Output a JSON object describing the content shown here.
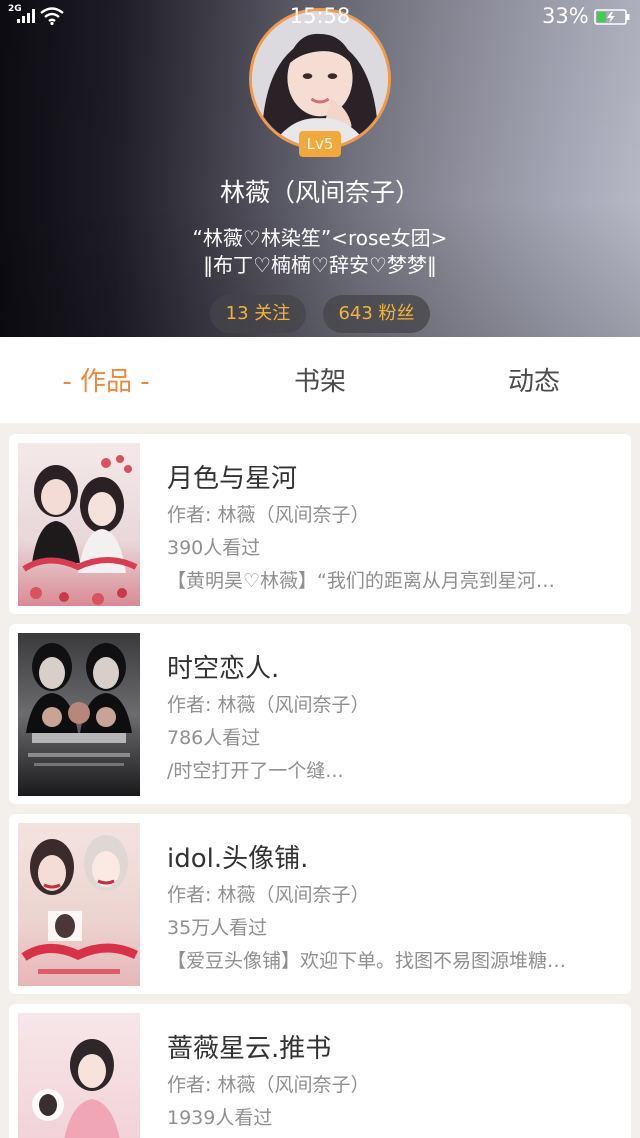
{
  "status_bar": {
    "network": "2G",
    "time": "15:58",
    "battery_percent": "33%",
    "battery_level": 0.33,
    "icons": [
      "signal-icon",
      "wifi-icon",
      "battery-icon"
    ]
  },
  "profile": {
    "level": "Lv5",
    "name": "林薇（风间奈子）",
    "bio_line1": "“林薇♡林染笙”<rose女团>",
    "bio_line2": "‖布丁♡楠楠♡辞安♡梦梦‖",
    "following": "13 关注",
    "followers": "643 粉丝"
  },
  "tabs": [
    {
      "label": "- 作品 -",
      "active": true
    },
    {
      "label": "书架",
      "active": false
    },
    {
      "label": "动态",
      "active": false
    }
  ],
  "books": [
    {
      "title": "月色与星河",
      "author": "作者: 林薇（风间奈子）",
      "views": "390人看过",
      "desc": "【黄明昊♡林薇】“我们的距离从月亮到星河…"
    },
    {
      "title": "时空恋人.",
      "author": "作者: 林薇（风间奈子）",
      "views": "786人看过",
      "desc": "/时空打开了一个缝..."
    },
    {
      "title": "idol.头像铺.",
      "author": "作者: 林薇（风间奈子）",
      "views": "35万人看过",
      "desc": "【爱豆头像铺】欢迎下单。找图不易图源堆糖…"
    },
    {
      "title": "蔷薇星云.推书",
      "author": "作者: 林薇（风间奈子）",
      "views": "1939人看过",
      "desc": ""
    }
  ],
  "colors": {
    "accent": "#e98a3e",
    "level_badge": "#f0a93a",
    "pill_text": "#f2b33c",
    "page_bg": "#f3f0ec"
  }
}
